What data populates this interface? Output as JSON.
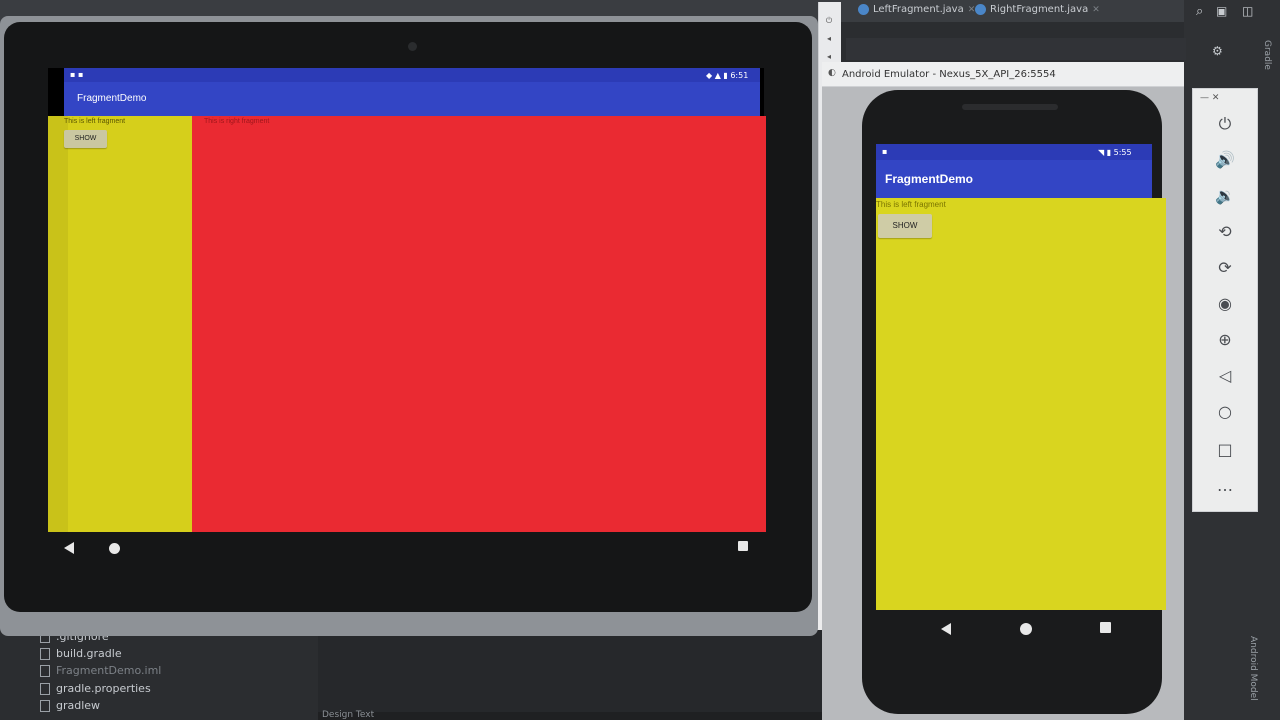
{
  "ide": {
    "tabs": [
      {
        "label": "LeftFragment.java"
      },
      {
        "label": "RightFragment.java"
      }
    ],
    "right_vertical_label": "Gradle",
    "bottom_vertical_label": "Android Model",
    "project_tree": [
      {
        "label": ".gitignore"
      },
      {
        "label": "build.gradle"
      },
      {
        "label": "FragmentDemo.iml"
      },
      {
        "label": "gradle.properties"
      },
      {
        "label": "gradlew"
      }
    ],
    "bottom_panel_label": "Design   Text"
  },
  "tablet": {
    "status_left": "▪ ▪",
    "status_right": "◆ ▲ ▮ 6:51",
    "app_title": "FragmentDemo",
    "left_fragment_text": "This is left fragment",
    "right_fragment_text": "This is right fragment",
    "button_label": "SHOW",
    "left_color": "#d6cf1b",
    "right_color": "#ea2a32",
    "appbar_color": "#3345c5"
  },
  "phone": {
    "window_title": "Android Emulator - Nexus_5X_API_26:5554",
    "status_left": "▪",
    "status_right": "◥ ▮ 5:55",
    "app_title": "FragmentDemo",
    "fragment_text": "This is left fragment",
    "button_label": "SHOW",
    "content_color": "#d9d51f"
  },
  "controls": {
    "window_buttons": "—  ✕",
    "items": [
      {
        "icon": "⏻"
      },
      {
        "icon": "🔊"
      },
      {
        "icon": "🔉"
      },
      {
        "icon": "⟲"
      },
      {
        "icon": "⟳"
      },
      {
        "icon": "◉"
      },
      {
        "icon": "⊕"
      },
      {
        "icon": "◁"
      },
      {
        "icon": "○"
      },
      {
        "icon": "□"
      },
      {
        "icon": "…"
      }
    ]
  }
}
